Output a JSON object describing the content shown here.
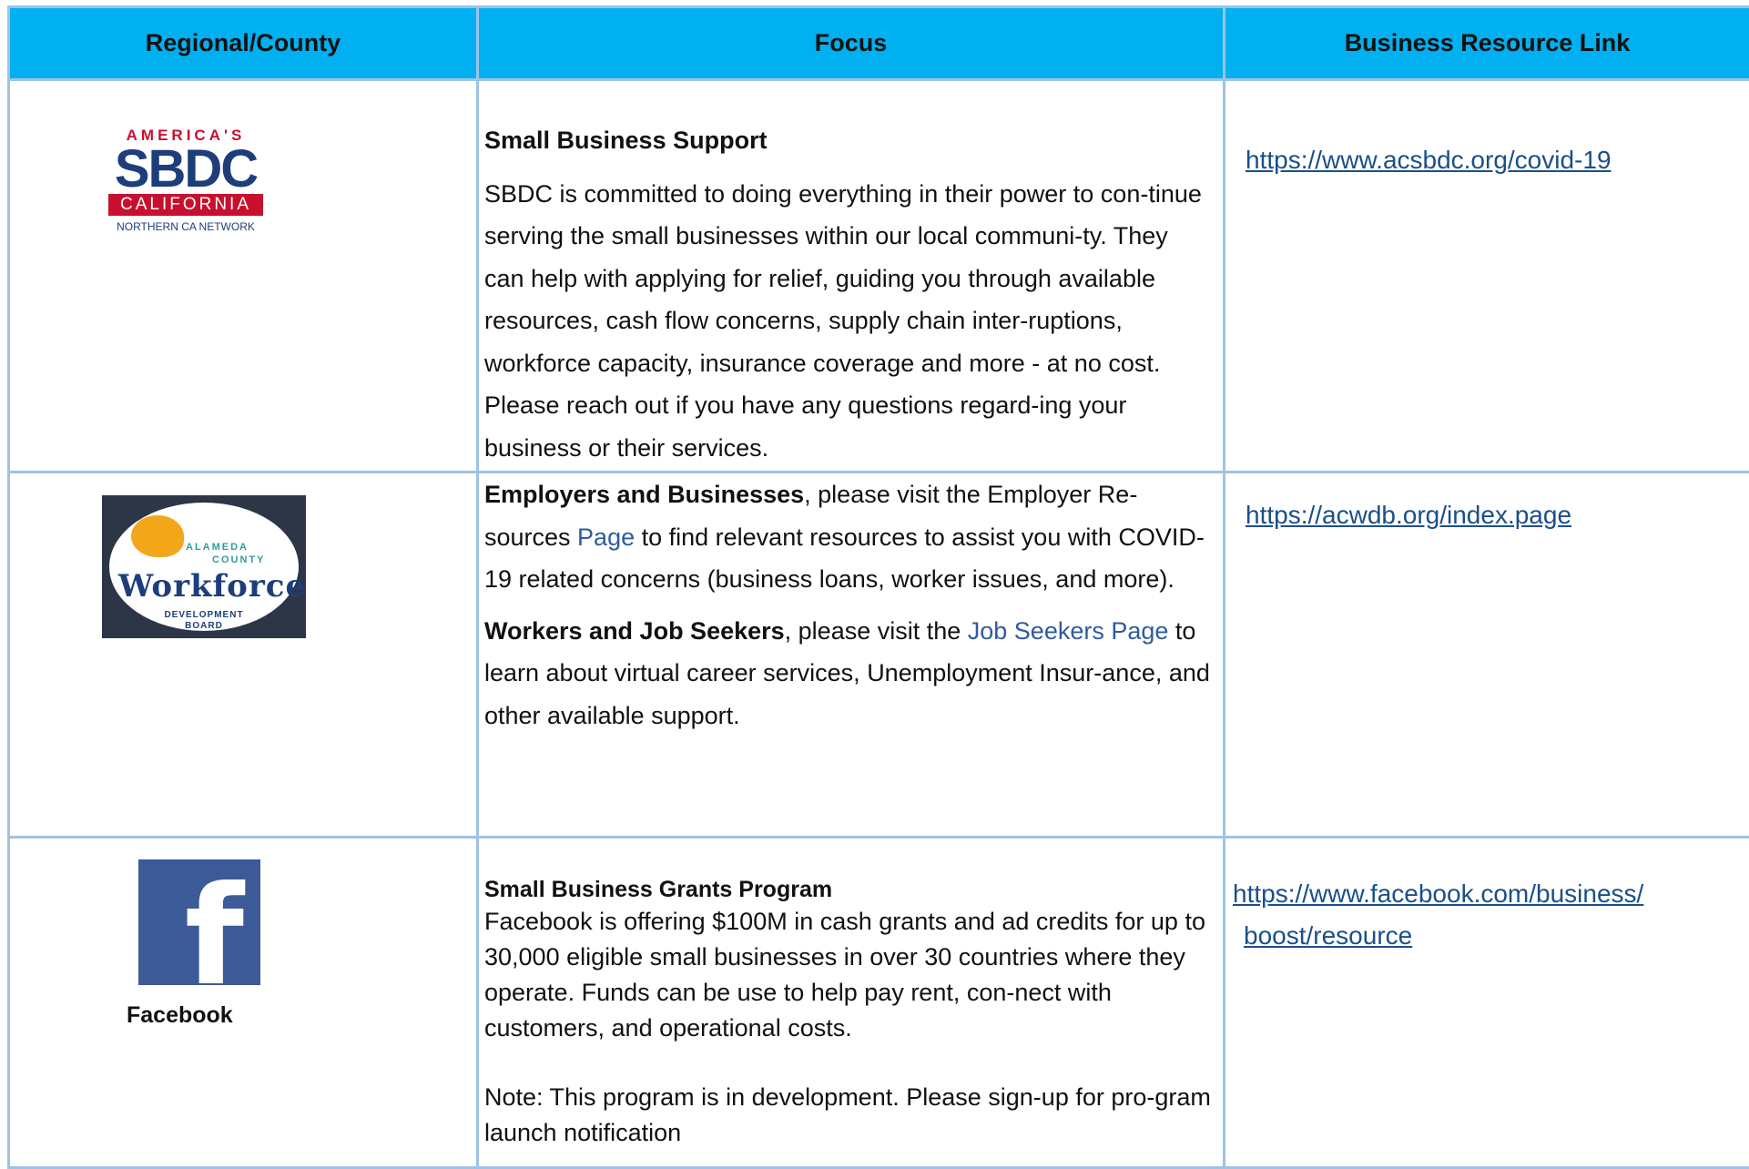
{
  "headers": [
    "Regional/County",
    "Focus",
    "Business Resource Link"
  ],
  "rows": [
    {
      "logo": {
        "top": "AMERICA'S",
        "main": "SBDC",
        "band": "CALIFORNIA",
        "sub": "NORTHERN CA NETWORK"
      },
      "heading": "Small Business Support",
      "body": "SBDC is committed to doing everything in their power to con-tinue serving the small businesses within our local communi-ty. They can help with applying for relief, guiding you through available resources, cash flow concerns, supply chain inter-ruptions, workforce capacity, insurance coverage and more - at no cost. Please reach out if you have any questions regard-ing your business or their services.",
      "link": "https://www.acsbdc.org/covid-19"
    },
    {
      "logo": {
        "line1": "ALAMEDA",
        "line2": "COUNTY",
        "main": "Workforce",
        "line3": "DEVELOPMENT",
        "line4": "BOARD"
      },
      "p1": {
        "bold": "Employers and Businesses",
        "t1": ", please visit the Employer Re-sources ",
        "link": "Page",
        "t2": " to find relevant resources to assist you with COVID-19 related concerns (business loans, worker issues, and more)."
      },
      "p2": {
        "bold": "Workers and Job Seekers",
        "t1": ", please visit the ",
        "link": "Job Seekers Page",
        "t2": " to learn about virtual career services, Unemployment Insur-ance, and other available support."
      },
      "link": "https://acwdb.org/index.page"
    },
    {
      "logo": {
        "glyph": "f",
        "label": "Facebook"
      },
      "heading": "Small Business Grants Program",
      "body": "Facebook is offering $100M in cash grants and ad credits for up to 30,000 eligible small businesses in over 30 countries where they operate. Funds can be use to help pay rent, con-nect with customers, and operational costs.",
      "note": "Note: This program is in development. Please sign-up for pro-gram launch notification",
      "link_line1": "https://www.facebook.com/business/",
      "link_line2": "boost/resource"
    }
  ],
  "colors": {
    "header_bg": "#00b0f0",
    "border": "#9dc3e6",
    "link": "#1a4f8a",
    "sbdc_red": "#c8102e",
    "sbdc_blue": "#1d3e7a",
    "facebook_blue": "#3d5a98"
  }
}
